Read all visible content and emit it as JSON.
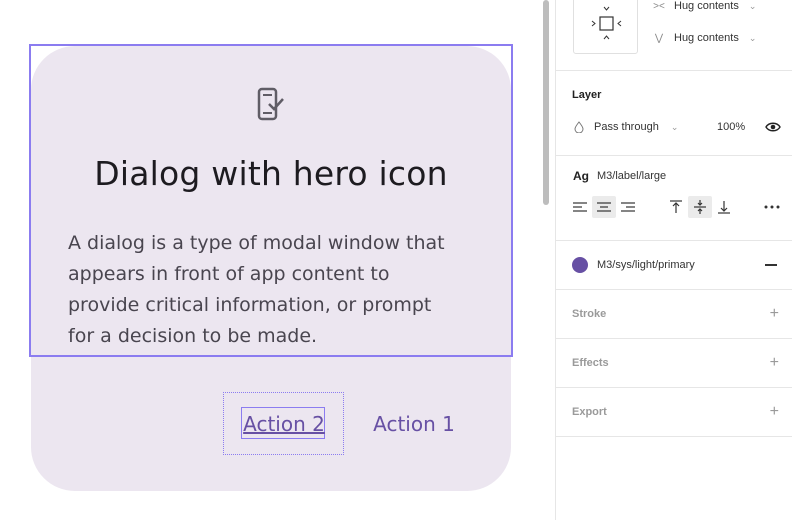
{
  "canvas": {
    "dialog": {
      "title": "Dialog with hero icon",
      "body": "A dialog is a type of modal window that appears in front of app content to provide critical information, or prompt for a decision to be made.",
      "body_lines": [
        "A dialog is a type of modal window that",
        "appears in front of app content to",
        "provide critical information, or prompt",
        "for a decision to be made."
      ],
      "action_2": "Action 2",
      "action_1": "Action 1",
      "icon": "phone-check-icon"
    }
  },
  "panel": {
    "auto_layout": {
      "width_mode": "Hug contents",
      "height_mode": "Hug contents"
    },
    "layer": {
      "title": "Layer",
      "blend_mode": "Pass through",
      "opacity": "100%"
    },
    "text": {
      "ag_label": "Ag",
      "style_name": "M3/label/large"
    },
    "fill": {
      "style_name": "M3/sys/light/primary",
      "color": "#6750a4"
    },
    "stroke": {
      "title": "Stroke"
    },
    "effects": {
      "title": "Effects"
    },
    "export": {
      "title": "Export"
    }
  },
  "colors": {
    "dialog_bg": "#ece6f0",
    "selection": "#8b7cf0",
    "primary": "#6750a4"
  }
}
